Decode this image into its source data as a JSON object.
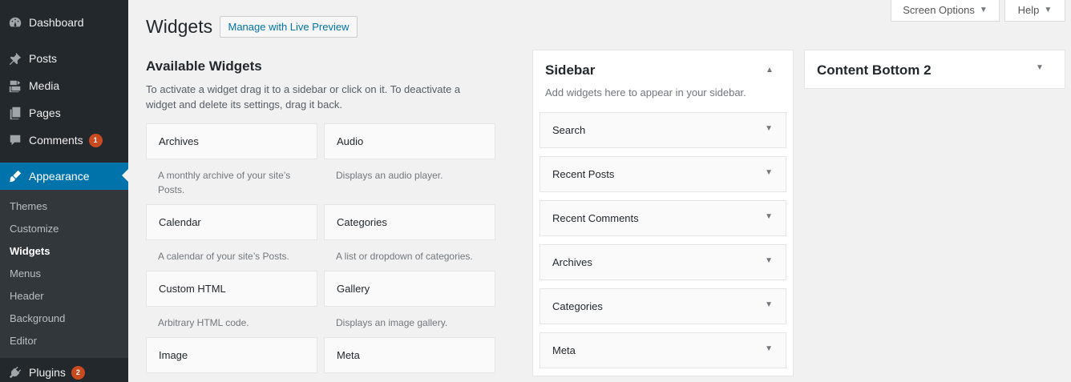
{
  "admin_menu": {
    "items": [
      {
        "label": "Dashboard",
        "icon": "dashboard-icon"
      },
      {
        "label": "Posts",
        "icon": "pin-icon"
      },
      {
        "label": "Media",
        "icon": "media-icon"
      },
      {
        "label": "Pages",
        "icon": "pages-icon"
      },
      {
        "label": "Comments",
        "icon": "comment-icon",
        "badge": "1"
      },
      {
        "label": "Appearance",
        "icon": "brush-icon",
        "current": true
      },
      {
        "label": "Plugins",
        "icon": "plugin-icon",
        "badge": "2"
      }
    ],
    "submenu": [
      "Themes",
      "Customize",
      "Widgets",
      "Menus",
      "Header",
      "Background",
      "Editor"
    ],
    "submenu_current": "Widgets"
  },
  "screen_meta": {
    "screen_options": "Screen Options",
    "help": "Help"
  },
  "page": {
    "title": "Widgets",
    "live_preview": "Manage with Live Preview"
  },
  "available": {
    "title": "Available Widgets",
    "description": "To activate a widget drag it to a sidebar or click on it. To deactivate a widget and delete its settings, drag it back.",
    "widgets": [
      {
        "name": "Archives",
        "desc": "A monthly archive of your site’s Posts."
      },
      {
        "name": "Audio",
        "desc": "Displays an audio player."
      },
      {
        "name": "Calendar",
        "desc": "A calendar of your site’s Posts."
      },
      {
        "name": "Categories",
        "desc": "A list or dropdown of categories."
      },
      {
        "name": "Custom HTML",
        "desc": "Arbitrary HTML code."
      },
      {
        "name": "Gallery",
        "desc": "Displays an image gallery."
      },
      {
        "name": "Image",
        "desc": ""
      },
      {
        "name": "Meta",
        "desc": ""
      }
    ]
  },
  "sidebar": {
    "title": "Sidebar",
    "description": "Add widgets here to appear in your sidebar.",
    "widgets": [
      "Search",
      "Recent Posts",
      "Recent Comments",
      "Archives",
      "Categories",
      "Meta"
    ]
  },
  "content_bottom_2": {
    "title": "Content Bottom 2"
  },
  "colors": {
    "menu_bg": "#23282d",
    "submenu_bg": "#32373c",
    "accent": "#0073aa",
    "badge": "#ca4a1f"
  }
}
